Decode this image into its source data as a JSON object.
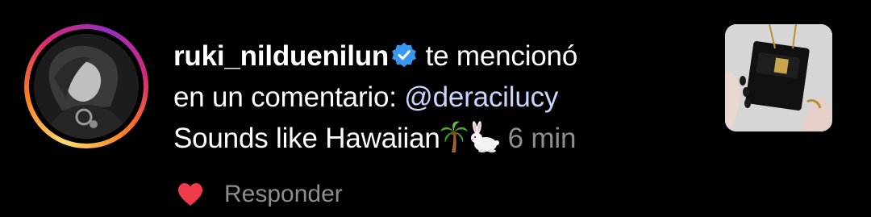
{
  "notification": {
    "username": "ruki_nilduenilun",
    "action_text_1": " te mencionó",
    "action_text_2": "en un comentario: ",
    "mention": "@deracilucy",
    "comment_text": "Sounds like Hawaiian",
    "emoji_1": "🌴",
    "emoji_2": "🐇",
    "timestamp": "6 min",
    "reply_label": "Responder"
  },
  "colors": {
    "like": "#ef3a4a",
    "verified": "#3897f0",
    "secondary_text": "#8e8e8e",
    "mention": "#c8d6ff"
  },
  "icons": {
    "verified": "verified-badge-icon",
    "like": "heart-icon"
  }
}
